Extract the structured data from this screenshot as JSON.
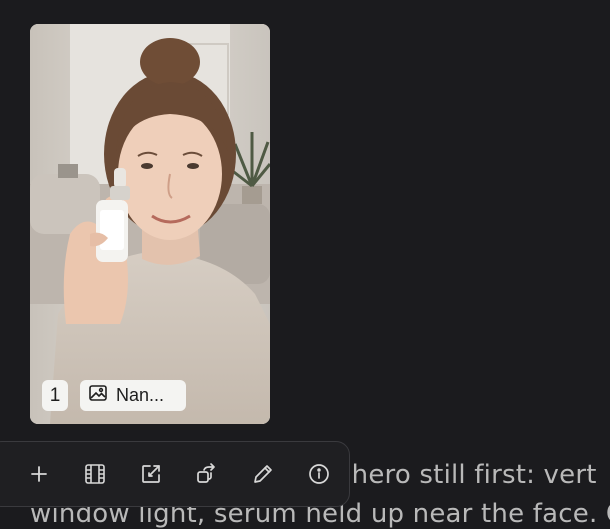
{
  "attachment": {
    "index": "1",
    "label": "Nan...",
    "icons": {
      "type": "image-icon"
    }
  },
  "message": {
    "line1": "e hero still first: vert",
    "line2": "window light, serum held up near the face. O"
  },
  "toolbar": {
    "icons": [
      "plus-icon",
      "film-icon",
      "external-link-icon",
      "share-icon",
      "pencil-icon",
      "info-icon"
    ]
  },
  "colors": {
    "background": "#1b1b1e",
    "toolbar_bg": "#1f1f22",
    "toolbar_border": "#3a3a3e",
    "text": "#b9b9b9",
    "badge_bg": "#f4f4f2"
  }
}
